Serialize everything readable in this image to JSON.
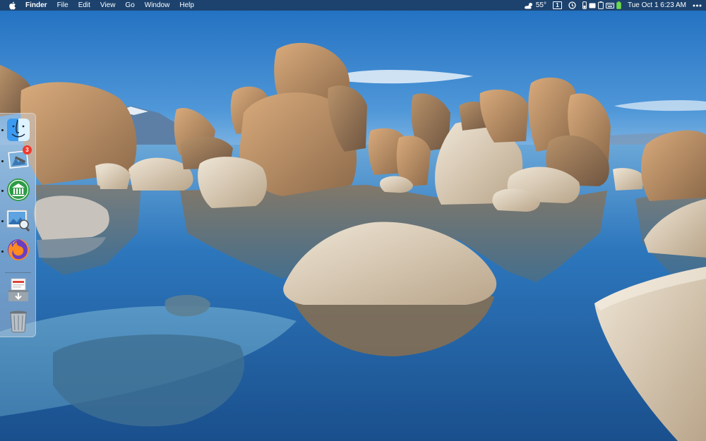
{
  "menubar": {
    "apple_icon": "apple-logo-icon",
    "app_name": "Finder",
    "menus": [
      "File",
      "Edit",
      "View",
      "Go",
      "Window",
      "Help"
    ],
    "status": {
      "weather_icon": "cloud-sun-icon",
      "weather_temp": "55°",
      "desktop_space_number": "1",
      "datetime": "Tue Oct 1  6:23 AM",
      "more_icon": "ellipsis-icon"
    }
  },
  "dock": {
    "apps": [
      {
        "name": "Finder",
        "icon": "finder-icon",
        "running": true
      },
      {
        "name": "Mail",
        "icon": "mail-icon",
        "running": true,
        "badge": "3"
      },
      {
        "name": "Bank",
        "icon": "bank-icon",
        "running": true
      },
      {
        "name": "Preview",
        "icon": "preview-icon",
        "running": true
      },
      {
        "name": "Firefox",
        "icon": "firefox-icon",
        "running": true
      }
    ],
    "extras": [
      {
        "name": "Downloads",
        "icon": "downloads-stack-icon"
      },
      {
        "name": "Trash",
        "icon": "trash-icon"
      }
    ]
  },
  "colors": {
    "menubar_bg": "#1c3a60",
    "badge_red": "#f03a2e",
    "sky_top": "#2f7dc9",
    "water": "#1f63a8"
  }
}
